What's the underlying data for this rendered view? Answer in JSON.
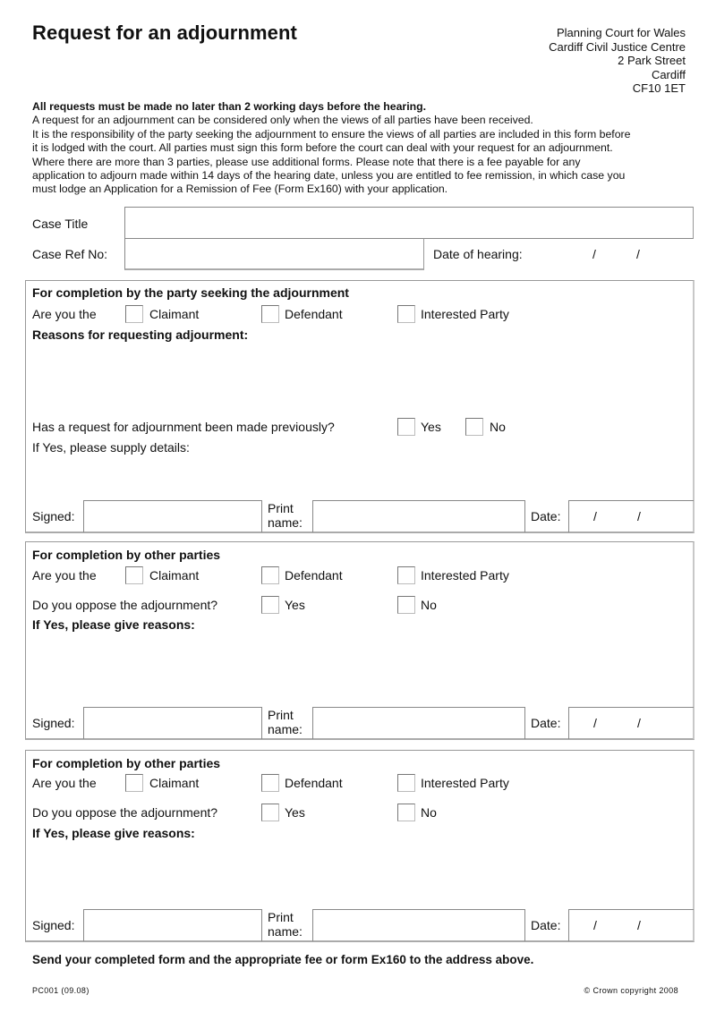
{
  "header": {
    "title": "Request for an adjournment",
    "address": [
      "Planning Court for Wales",
      "Cardiff Civil Justice Centre",
      "2 Park Street",
      "Cardiff",
      "CF10 1ET"
    ]
  },
  "intro": {
    "bold_line": "All requests must be made no later than 2 working days before the hearing.",
    "lines": [
      "A request for an adjournment can be considered only when the views of all parties have been received.",
      "It is the responsibility of the party seeking the adjournment to ensure the views of all parties are included in this form before",
      "it is lodged with the court. All parties must sign this form before the court can deal with your request for an adjournment.",
      "Where there are more than 3 parties, please use additional forms. Please note that there is a fee payable for any",
      "application to adjourn made within 14 days of the hearing date, unless you are entitled to fee remission, in which case you",
      "must lodge an Application for a Remission of Fee (Form Ex160) with your application."
    ]
  },
  "case": {
    "title_label": "Case Title",
    "title_value": "",
    "ref_label": "Case Ref No:",
    "ref_value": "",
    "hearing_label": "Date of hearing:",
    "date_sep": "/"
  },
  "section1": {
    "heading": "For completion by the party seeking the adjournment",
    "are_you_label": "Are you the",
    "options": [
      "Claimant",
      "Defendant",
      "Interested Party"
    ],
    "reasons_label": "Reasons for requesting adjourment:",
    "previous_question": "Has a request for adjournment been made previously?",
    "yes": "Yes",
    "no": "No",
    "details_label": "If Yes, please supply details:"
  },
  "other_section": {
    "heading": "For completion by other parties",
    "are_you_label": "Are you the",
    "options": [
      "Claimant",
      "Defendant",
      "Interested Party"
    ],
    "oppose_question": "Do you oppose the adjournment?",
    "yes": "Yes",
    "no": "No",
    "reasons_label": "If Yes, please give reasons:"
  },
  "signature": {
    "signed_label": "Signed:",
    "print_label_1": "Print",
    "print_label_2": "name:",
    "date_label": "Date:",
    "date_sep": "/"
  },
  "footer": {
    "instruction": "Send your completed form and the appropriate fee  or form Ex160 to the address above.",
    "form_code": "PC001 (09.08)",
    "copyright": "© Crown copyright 2008"
  }
}
